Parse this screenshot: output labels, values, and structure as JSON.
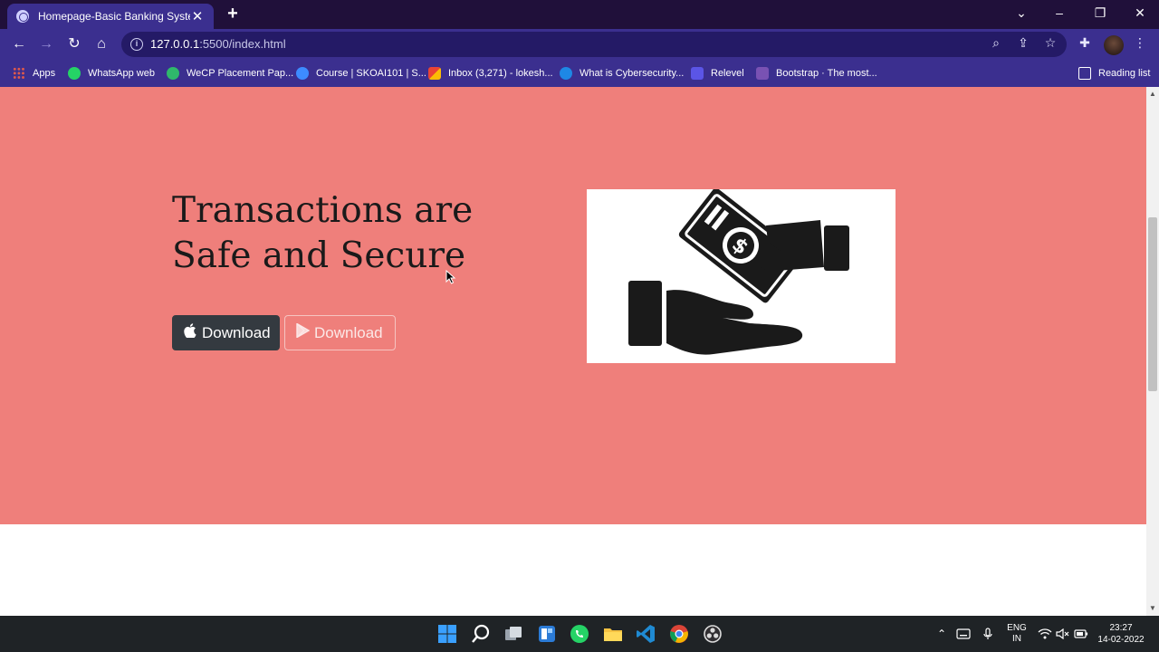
{
  "browser": {
    "tab": {
      "title": "Homepage-Basic Banking System",
      "close": "✕"
    },
    "new_tab": "+",
    "window_controls": {
      "minimize": "–",
      "restore": "❐",
      "close": "✕",
      "tab_search": "⌄"
    },
    "url": {
      "host": "127.0.0.1",
      "rest": ":5500/index.html"
    },
    "bookmarks": [
      {
        "label": "Apps",
        "color": "#e25a4a"
      },
      {
        "label": "WhatsApp web",
        "color": "#25d366"
      },
      {
        "label": "WeCP Placement Pap...",
        "color": "#2fb86b"
      },
      {
        "label": "Course | SKOAI101 | S...",
        "color": "#3d8bff"
      },
      {
        "label": "Inbox (3,271) - lokesh...",
        "color": "#ea4335"
      },
      {
        "label": "What is Cybersecurity...",
        "color": "#1e88e5"
      },
      {
        "label": "Relevel",
        "color": "#5b55e6"
      },
      {
        "label": "Bootstrap · The most...",
        "color": "#7952b3"
      }
    ],
    "reading_list": "Reading list"
  },
  "page": {
    "hero": {
      "heading": "Transactions are Safe and Secure",
      "buttons": {
        "apple": "Download",
        "play": "Download"
      }
    },
    "colors": {
      "hero_bg": "#ef7f7b",
      "dark_button": "#343a40"
    }
  },
  "taskbar": {
    "language": {
      "line1": "ENG",
      "line2": "IN"
    },
    "time": "23:27",
    "date": "14-02-2022"
  }
}
